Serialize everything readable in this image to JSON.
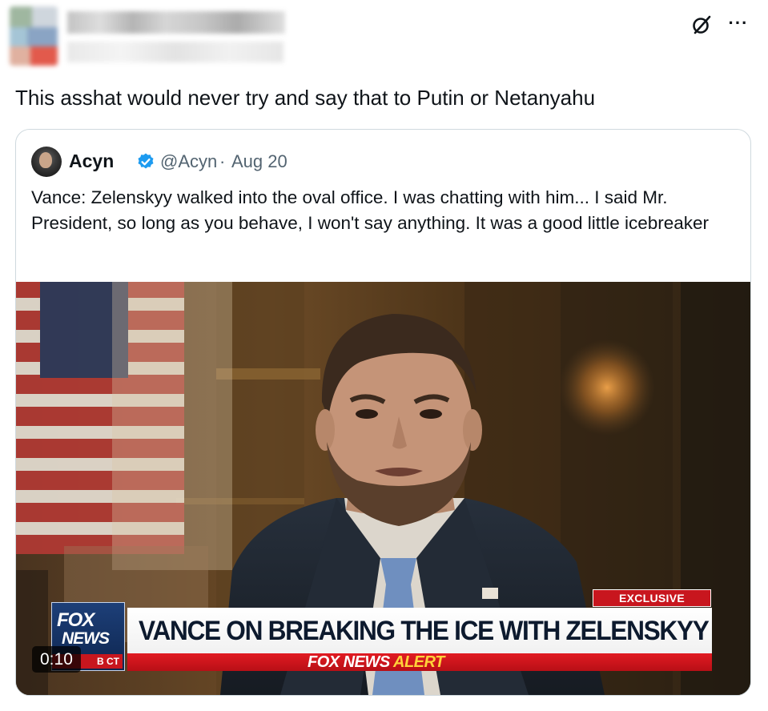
{
  "post": {
    "author_name": "",
    "author_handle": "",
    "text": "This asshat would never try and say that to Putin or Netanyahu"
  },
  "actions": {
    "grok_icon": "grok-icon",
    "more_icon": "more-icon",
    "more_label": "···"
  },
  "quoted_post": {
    "name": "Acyn",
    "verified": true,
    "handle": "@Acyn",
    "separator": "·",
    "date": "Aug 20",
    "text": "Vance: Zelenskyy walked into the oval office. I was chatting with him... I said Mr. President, so long as you behave, I won't say anything. It was a good little icebreaker"
  },
  "video": {
    "duration": "0:10",
    "exclusive_label": "EXCLUSIVE",
    "headline": "VANCE ON BREAKING THE ICE WITH ZELENSKYY",
    "alert_prefix": "FOX NEWS",
    "alert_suffix": "ALERT",
    "logo_top": "FOX",
    "logo_bottom": "NEWS",
    "logo_time": "B CT"
  },
  "colors": {
    "verified_blue": "#1d9bf0",
    "fox_red": "#c8161e",
    "alert_yellow": "#ffd23a",
    "text_primary": "#0f1419",
    "text_secondary": "#536471",
    "border": "#cfd9de"
  }
}
